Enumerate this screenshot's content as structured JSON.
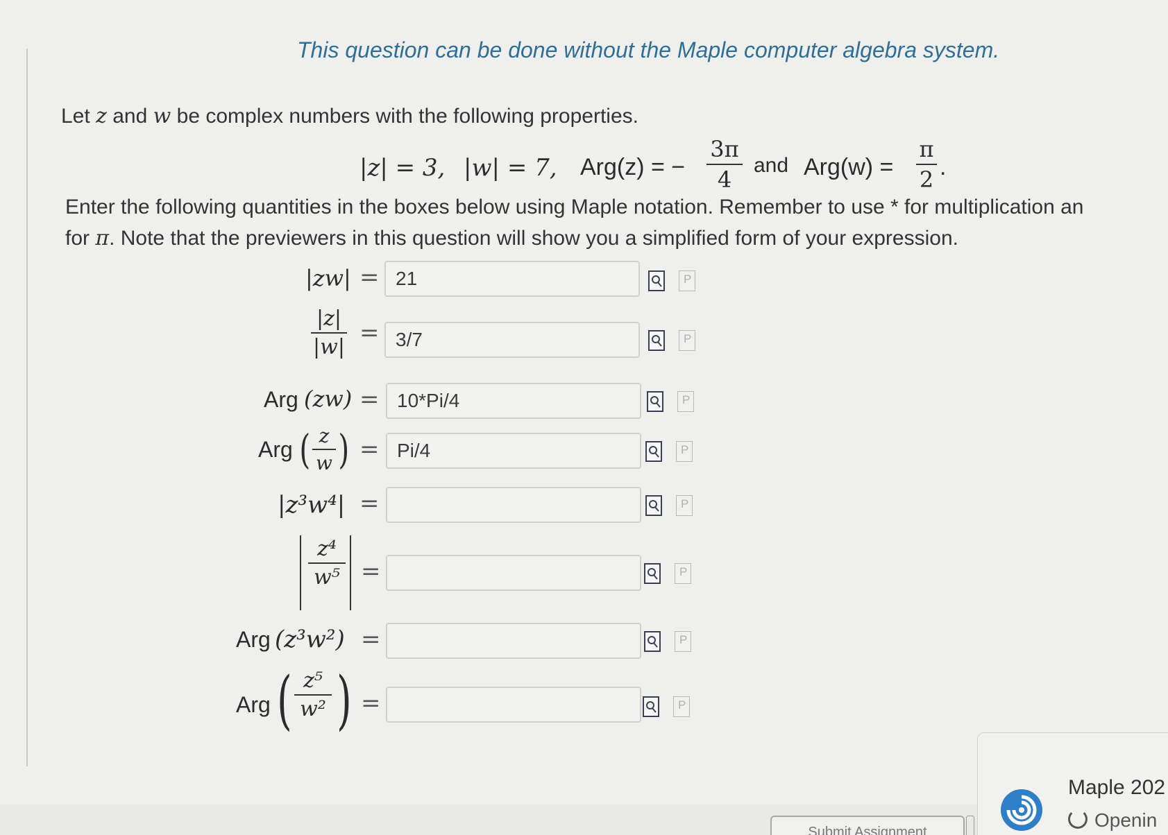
{
  "note": "This question can be done without the Maple computer algebra system.",
  "intro": {
    "let": "Let",
    "var_z": "z",
    "and": "and",
    "var_w": "w",
    "rest": "be complex numbers with the following properties."
  },
  "given": {
    "abs_z": "|z| = 3,",
    "abs_w": "|w| = 7,",
    "arg_z_label": "Arg(z) = −",
    "arg_z_num": "3π",
    "arg_z_den": "4",
    "and": "and",
    "arg_w_label": "Arg(w) =",
    "arg_w_num": "π",
    "arg_w_den": "2",
    "end": "."
  },
  "instructions": {
    "line1": "Enter the following quantities in the boxes below using Maple notation.  Remember to use * for multiplication an",
    "line2_a": "for",
    "line2_pi": "π",
    "line2_b": ". Note that the previewers in this question will show you a simplified form of your expression."
  },
  "rows": [
    {
      "lhs": "|zw|",
      "value": "21"
    },
    {
      "lhs_num": "|z|",
      "lhs_den": "|w|",
      "value": "3/7"
    },
    {
      "lhs_text": "Arg",
      "lhs_expr": "(zw)",
      "value": "10*Pi/4"
    },
    {
      "lhs_text": "Arg",
      "lhs_num": "z",
      "lhs_den": "w",
      "value": "Pi/4"
    },
    {
      "lhs": "|z³w⁴|",
      "value": ""
    },
    {
      "lhs_num": "z⁴",
      "lhs_den": "w⁵",
      "value": ""
    },
    {
      "lhs_text": "Arg",
      "lhs_expr": "(z³w²)",
      "value": ""
    },
    {
      "lhs_text": "Arg",
      "lhs_num": "z⁵",
      "lhs_den": "w²",
      "value": ""
    }
  ],
  "equals": "=",
  "preview_icon": "preview-icon",
  "p_icon_letter": "P",
  "submit_label": "Submit Assignment",
  "maple": {
    "title": "Maple 202",
    "status": "Openin"
  }
}
